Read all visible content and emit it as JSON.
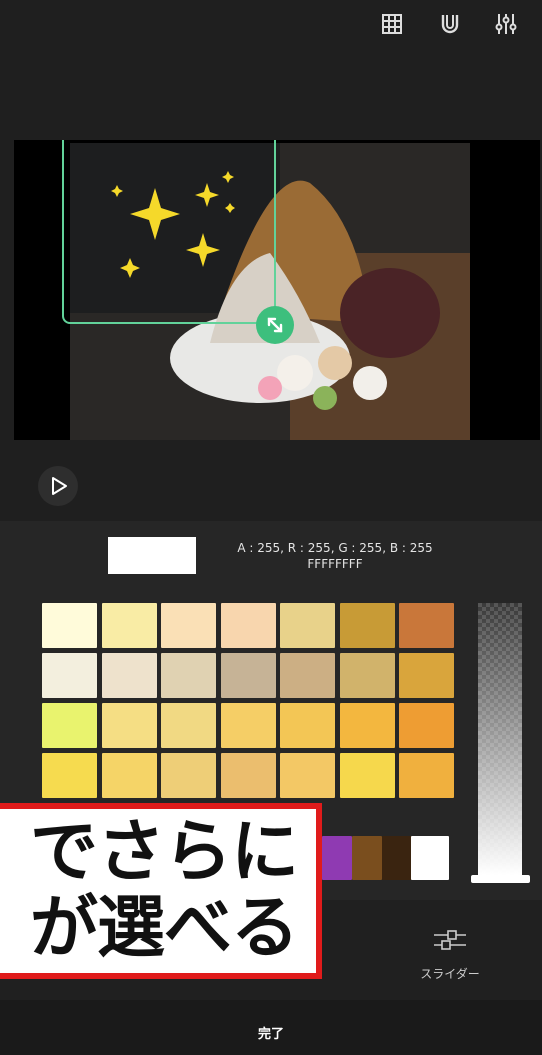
{
  "toolbar": {
    "icons": [
      "grid-icon",
      "magnet-icon",
      "adjust-sliders-icon"
    ]
  },
  "color_picker": {
    "current_color_hex": "#FFFFFF",
    "argb_text": "A : 255, R : 255, G : 255, B : 255",
    "hex_text": "FFFFFFFF",
    "palette_rows": [
      [
        "#FFFBDA",
        "#F9ECA5",
        "#FAE0B6",
        "#F8D6AE",
        "#E8D28A",
        "#C89B36",
        "#C9773A"
      ],
      [
        "#F3EFDE",
        "#EEE2CC",
        "#E0D2B2",
        "#C6B396",
        "#CCAF84",
        "#D1B36B",
        "#D9A53C"
      ],
      [
        "#E9F36E",
        "#F5DE84",
        "#F1D983",
        "#F5CE66",
        "#F3C655",
        "#F3B73F",
        "#EE9D33"
      ],
      [
        "#F6DB4F",
        "#F5D467",
        "#EECE77",
        "#EBBE6E",
        "#F3C865",
        "#F6D84C",
        "#F0B03E"
      ]
    ],
    "bottom_strip": [
      "#8F3AB2",
      "#7A4E1E",
      "#3A2410",
      "#FFFFFF"
    ]
  },
  "bottom_bar": {
    "slider_label": "スライダー",
    "done_label": "完了"
  },
  "overlay_banner": {
    "line1": "でさらに",
    "line2": "が選べる"
  }
}
